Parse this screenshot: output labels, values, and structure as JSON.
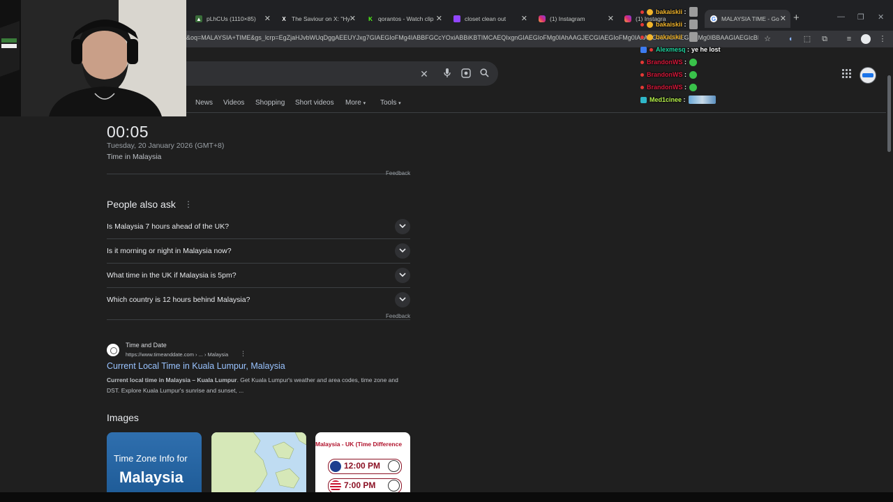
{
  "tabs": [
    {
      "title": "pLhCUs (1110×85)",
      "favicon": "image-icon"
    },
    {
      "title": "The Saviour on X: \"Hy",
      "favicon": "x-icon"
    },
    {
      "title": "qorantos - Watch clip",
      "favicon": "kick-icon"
    },
    {
      "title": "closet clean out",
      "favicon": "twitch-icon"
    },
    {
      "title": "(1) Instagram",
      "favicon": "instagram-icon"
    },
    {
      "title": "(1) Instagram",
      "favicon": "instagram-icon"
    },
    {
      "title": "MALAYSIA TIME - Go",
      "favicon": "google-icon"
    }
  ],
  "address": {
    "url": "&oq=MALAYSIA+TIME&gs_lcrp=EgZjaHJvbWUqDggAEEUYJxg7GIAEGIoFMg4IABBFGCcYOxiABBiKBTIMCAEQIxgnGIAEGIoFMg0IAhAAGJECGIAEGIoFMg0IAxAAGJECGIAEGIoFMg0IBBAAGIAEGIcBRA..."
  },
  "nav": {
    "tabs": [
      "News",
      "Videos",
      "Shopping",
      "Short videos",
      "More",
      "Tools"
    ]
  },
  "clock": {
    "time": "00:05",
    "date": "Tuesday, 20 January 2026 (GMT+8)",
    "zone": "Time in Malaysia",
    "feedback": "Feedback"
  },
  "paa": {
    "title": "People also ask",
    "questions": [
      "Is Malaysia 7 hours ahead of the UK?",
      "Is it morning or night in Malaysia now?",
      "What time in the UK if Malaysia is 5pm?",
      "Which country is 12 hours behind Malaysia?"
    ],
    "feedback": "Feedback"
  },
  "result": {
    "site": "Time and Date",
    "url": "https://www.timeanddate.com › ... › Malaysia",
    "title": "Current Local Time in Kuala Lumpur, Malaysia",
    "snippet_bold": "Current local time in Malaysia – Kuala Lumpur",
    "snippet_rest": ". Get Kuala Lumpur's weather and area codes, time zone and DST. Explore Kuala Lumpur's sunrise and sunset, ..."
  },
  "images": {
    "title": "Images",
    "img1_line1": "Time Zone Info for",
    "img1_line2": "Malaysia",
    "img3_header": "Malaysia - UK (Time Difference",
    "img3_time1": "12:00 PM",
    "img3_time2": "7:00 PM"
  },
  "chat": [
    {
      "user": "bakaiskii",
      "color": "#f2b52b",
      "message": "",
      "emote": "gray"
    },
    {
      "user": "bakaiskii",
      "color": "#f2b52b",
      "message": "",
      "emote": "gray"
    },
    {
      "user": "bakaiskii",
      "color": "#f2b52b",
      "message": "",
      "emote": "gray"
    },
    {
      "user": "Alexmesq",
      "color": "#1fd6a0",
      "message": "ye he lost",
      "emote": ""
    },
    {
      "user": "BrandonWS",
      "color": "#d6183a",
      "message": "",
      "emote": "green"
    },
    {
      "user": "BrandonWS",
      "color": "#d6183a",
      "message": "",
      "emote": "green"
    },
    {
      "user": "BrandonWS",
      "color": "#d6183a",
      "message": "",
      "emote": "green"
    },
    {
      "user": "Med1cinee",
      "color": "#b6f24a",
      "message": "",
      "emote": "wide"
    }
  ],
  "colors": {
    "background": "#1f1f1f",
    "link": "#99c3ff",
    "text": "#e8eaed"
  }
}
